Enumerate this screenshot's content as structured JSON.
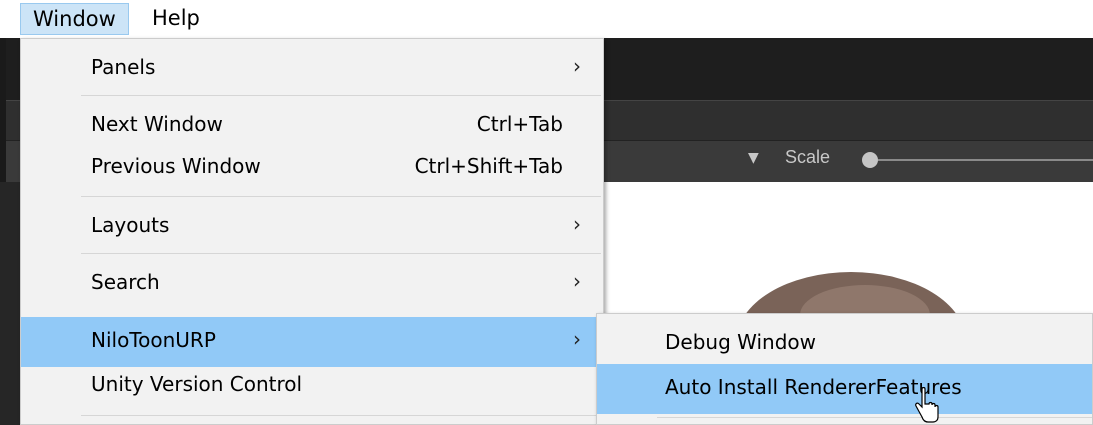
{
  "menubar": {
    "window_label": "Window",
    "help_label": "Help"
  },
  "toolbar": {
    "scale_label": "Scale"
  },
  "window_menu": {
    "items": [
      {
        "label": "Panels",
        "has_submenu": true
      },
      {
        "label": "Next Window",
        "shortcut": "Ctrl+Tab"
      },
      {
        "label": "Previous Window",
        "shortcut": "Ctrl+Shift+Tab"
      },
      {
        "label": "Layouts",
        "has_submenu": true
      },
      {
        "label": "Search",
        "has_submenu": true
      },
      {
        "label": "NiloToonURP",
        "has_submenu": true,
        "selected": true
      },
      {
        "label": "Unity Version Control"
      }
    ]
  },
  "niloToon_submenu": {
    "items": [
      {
        "label": "Debug Window"
      },
      {
        "label": "Auto Install RendererFeatures",
        "selected": true
      }
    ]
  },
  "colors": {
    "menu_bg": "#f2f2f2",
    "selection": "#91c9f7",
    "menubar_active": "#cce4f7",
    "editor_dark": "#282828"
  }
}
